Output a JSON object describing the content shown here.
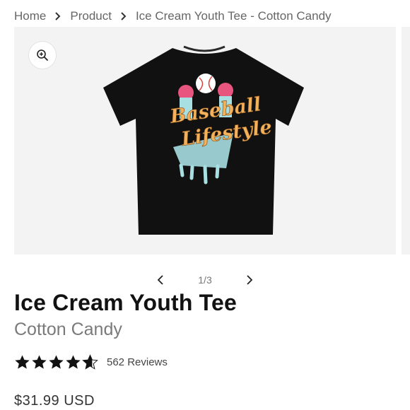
{
  "breadcrumb": {
    "items": [
      "Home",
      "Product",
      "Ice Cream Youth Tee - Cotton Candy"
    ]
  },
  "gallery": {
    "zoom_icon": "zoom-in-icon",
    "current": 1,
    "total": 3,
    "counter": "1/3",
    "prev_icon": "chevron-left-icon",
    "next_icon": "chevron-right-icon",
    "shirt_graphic_text": [
      "Baseball",
      "Lifestyle"
    ]
  },
  "product": {
    "title": "Ice Cream Youth Tee",
    "variant": "Cotton Candy",
    "rating": 4.6,
    "reviews_label": "562 Reviews",
    "price": "$31.99 USD"
  },
  "colors": {
    "text_dark": "#121212",
    "text_muted": "#7a7a7a",
    "gallery_bg": "#f3f3f3",
    "shirt": "#111111",
    "scoop_pink": "#e8557f",
    "scoop_blue": "#a7dfe2",
    "lettering": "#f2b15a"
  }
}
